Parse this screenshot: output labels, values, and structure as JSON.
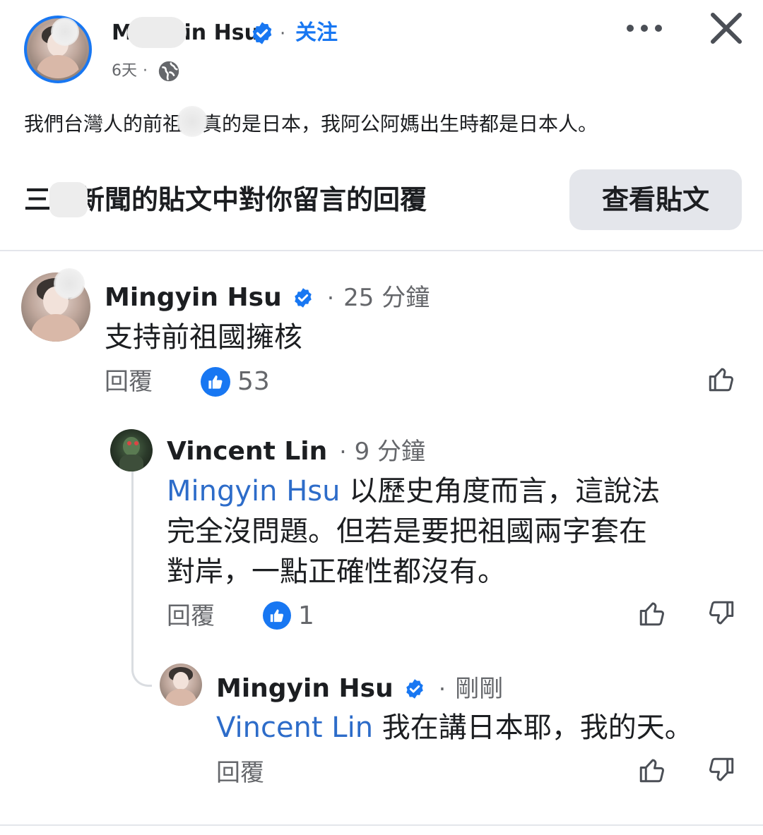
{
  "post": {
    "author_name": "Mingyin Hsu",
    "follow_label": "关注",
    "time": "6天",
    "dot": "·",
    "text": "我們台灣人的前祖國真的是日本，我阿公阿媽出生時都是日本人。"
  },
  "context_banner": {
    "text": "三立新聞的貼文中對你留言的回覆",
    "button_label": "查看貼文"
  },
  "comments": [
    {
      "author": "Mingyin Hsu",
      "time": "25 分鐘",
      "text": "支持前祖國擁核",
      "reply_label": "回覆",
      "likes": "53"
    },
    {
      "author": "Vincent Lin",
      "time": "9 分鐘",
      "mention": "Mingyin Hsu",
      "line1": " 以歷史角度而言，這說法",
      "line2": "完全沒問題。但若是要把祖國兩字套在",
      "line3": "對岸，一點正確性都沒有。",
      "reply_label": "回覆",
      "likes": "1"
    },
    {
      "author": "Mingyin Hsu",
      "time": "剛剛",
      "mention": "Vincent Lin",
      "text": " 我在講日本耶，我的天。",
      "reply_label": "回覆"
    }
  ],
  "colors": {
    "accent": "#1877f2",
    "mention": "#2d6cc9",
    "muted": "#65676b",
    "divider": "#e4e6eb",
    "button_bg": "#e4e6eb"
  },
  "icons": [
    "verified-badge-icon",
    "more-options-icon",
    "close-icon",
    "globe-icon",
    "like-reaction-icon",
    "thumbs-up-icon",
    "thumbs-down-icon"
  ]
}
